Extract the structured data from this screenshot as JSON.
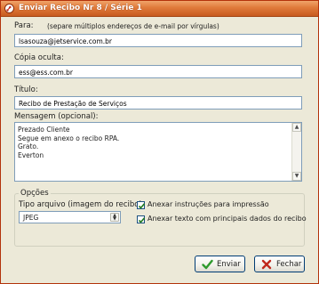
{
  "window": {
    "title": "Enviar Recibo Nr 8 / Série 1"
  },
  "para": {
    "label": "Para:",
    "hint": "(separe múltiplos endereços de e-mail por vírgulas)",
    "value": "lsasouza@jetservice.com.br"
  },
  "copia": {
    "label": "Cópia oculta:",
    "value": "ess@ess.com.br"
  },
  "titulo": {
    "label": "Título:",
    "value": "Recibo de Prestação de Serviços"
  },
  "mensagem": {
    "label": "Mensagem (opcional):",
    "lines": [
      "Prezado Cliente",
      "Segue em anexo o recibo RPA.",
      "Grato.",
      "Everton"
    ]
  },
  "opcoes": {
    "group_label": "Opções",
    "tipo_label": "Tipo arquivo (imagem do recibo):",
    "tipo_value": "JPEG",
    "check1_label": "Anexar instruções para impressão",
    "check1_checked": true,
    "check2_label": "Anexar texto com principais dados do recibo",
    "check2_checked": true
  },
  "buttons": {
    "enviar": "Enviar",
    "fechar": "Fechar"
  },
  "colors": {
    "titlebar": "#e07a3a",
    "window_bg": "#ece9d8",
    "enviar_icon": "#2e9a2e",
    "fechar_icon": "#c0281c"
  }
}
